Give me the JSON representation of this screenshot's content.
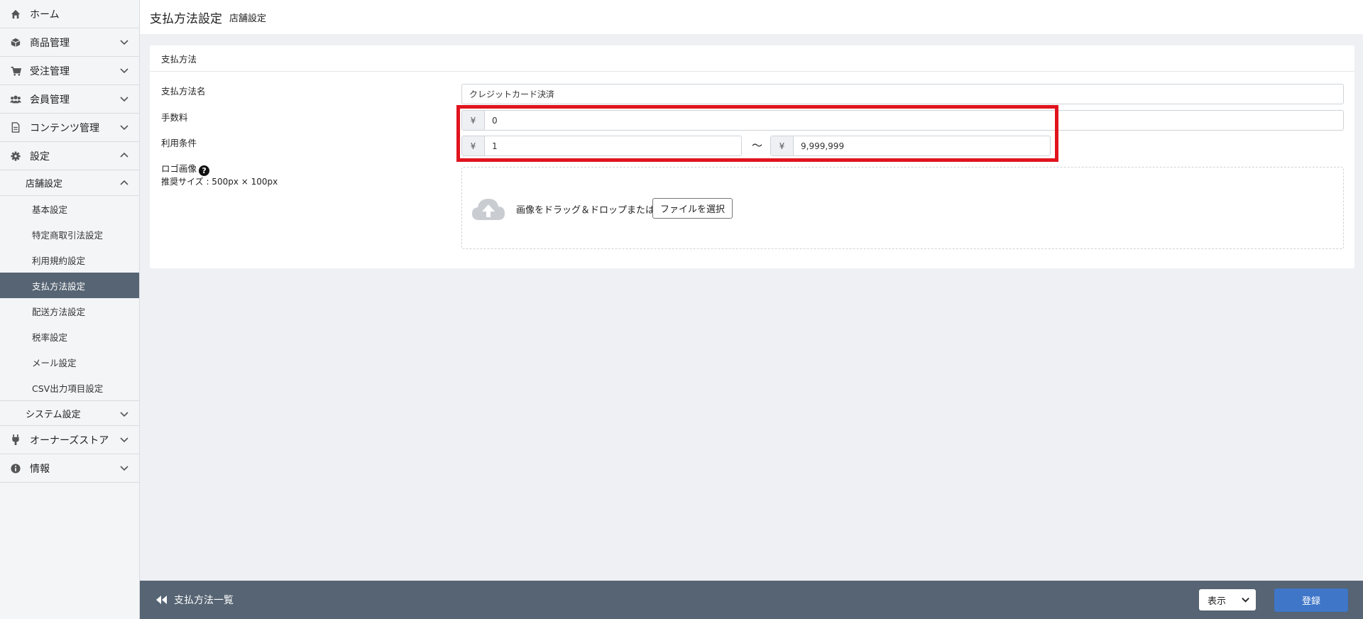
{
  "sidebar": {
    "items": [
      {
        "label": "ホーム",
        "icon": "home-icon"
      },
      {
        "label": "商品管理",
        "icon": "cube-icon"
      },
      {
        "label": "受注管理",
        "icon": "cart-icon"
      },
      {
        "label": "会員管理",
        "icon": "users-icon"
      },
      {
        "label": "コンテンツ管理",
        "icon": "document-icon"
      },
      {
        "label": "設定",
        "icon": "gear-icon"
      }
    ],
    "settings_sub": {
      "store_settings": "店舗設定",
      "leaves": [
        "基本設定",
        "特定商取引法設定",
        "利用規約設定",
        "支払方法設定",
        "配送方法設定",
        "税率設定",
        "メール設定",
        "CSV出力項目設定"
      ],
      "active_leaf": "支払方法設定",
      "system_settings": "システム設定"
    },
    "bottom_items": [
      {
        "label": "オーナーズストア",
        "icon": "plug-icon"
      },
      {
        "label": "情報",
        "icon": "info-icon"
      }
    ]
  },
  "header": {
    "title": "支払方法設定",
    "subtitle": "店舗設定"
  },
  "card": {
    "heading": "支払方法",
    "name_label": "支払方法名",
    "name_value": "クレジットカード決済",
    "fee_label": "手数料",
    "currency_symbol": "¥",
    "fee_value": "0",
    "condition_label": "利用条件",
    "min_value": "1",
    "range_separator": "〜",
    "max_value": "9,999,999",
    "logo_label": "ロゴ画像",
    "help_symbol": "?",
    "logo_hint": "推奨サイズ : 500px × 100px",
    "drop_text": "画像をドラッグ＆ドロップまたは",
    "file_button": "ファイルを選択"
  },
  "footer": {
    "back_label": "支払方法一覧",
    "visibility_value": "表示",
    "register_label": "登録"
  },
  "colors": {
    "highlight": "#e0141e",
    "active_nav": "#566473",
    "primary_button": "#3f76c8"
  }
}
